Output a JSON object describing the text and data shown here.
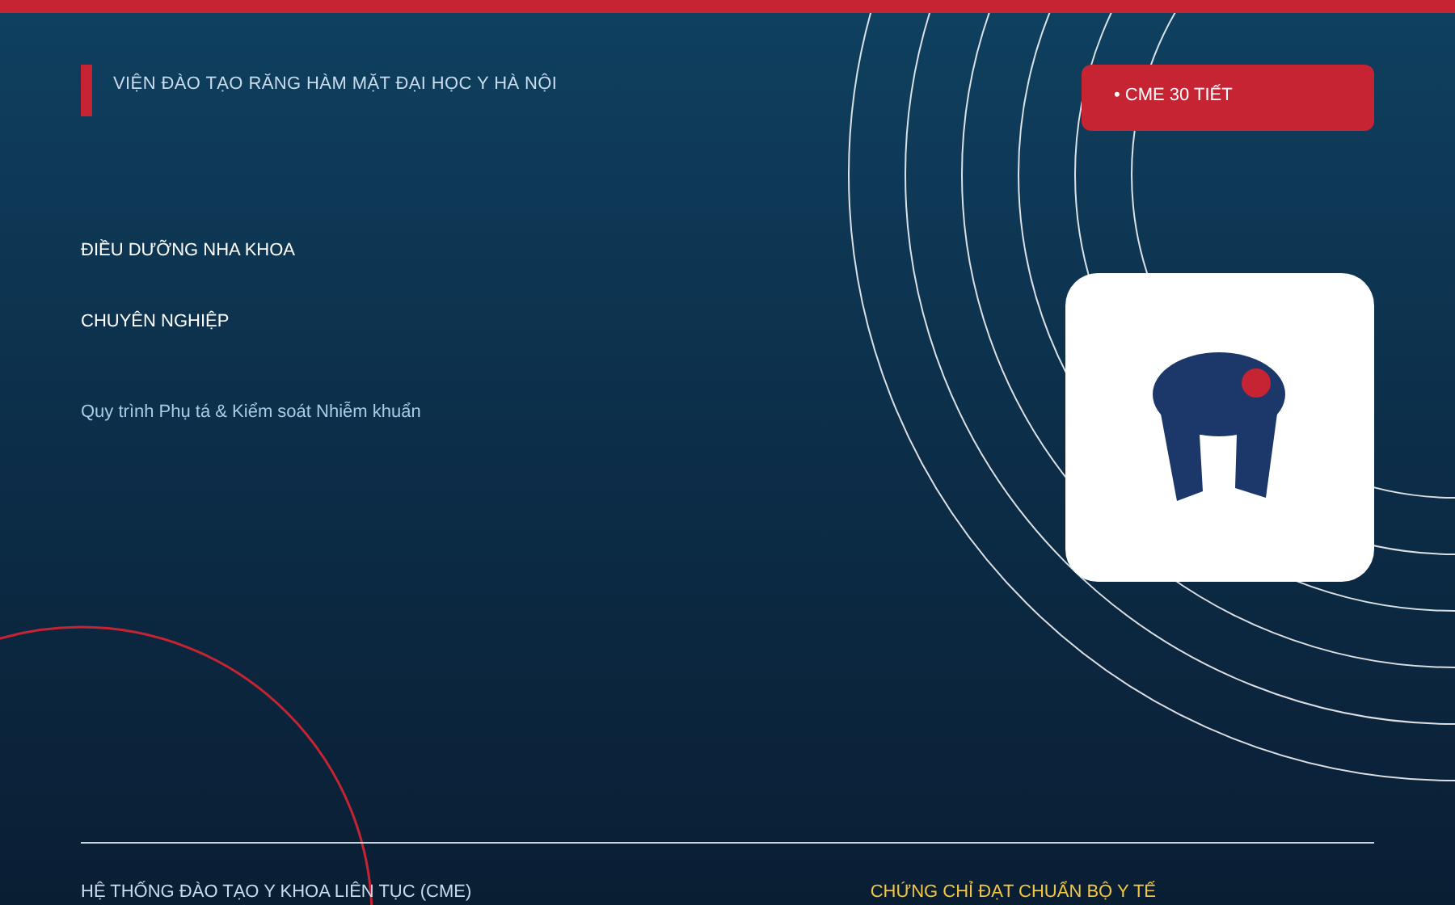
{
  "header": {
    "institute": "VIỆN ĐÀO TẠO RĂNG HÀM MẶT ĐẠI HỌC Y HÀ NỘI",
    "badge": "• CME 30 TIẾT"
  },
  "hero": {
    "title": "ĐIỀU DƯỠNG NHA KHOA CHUYÊN NGHIỆP",
    "subtitle": "Quy trình Phụ tá & Kiểm soát Nhiễm khuẩn"
  },
  "footer": {
    "left": "HỆ THỐNG ĐÀO TẠO Y KHOA LIÊN TỤC (CME)",
    "right": "CHỨNG CHỈ ĐẠT CHUẨN BỘ Y TẾ"
  }
}
